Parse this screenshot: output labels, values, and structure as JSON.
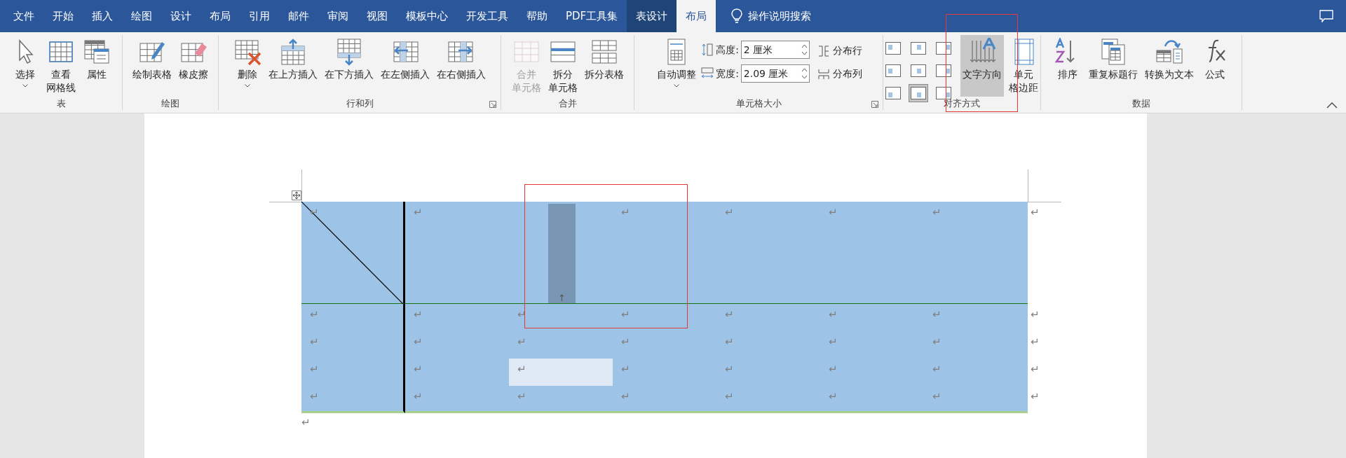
{
  "tabs": [
    {
      "label": "文件",
      "kind": "plain",
      "selected": false
    },
    {
      "label": "开始",
      "kind": "plain",
      "selected": false
    },
    {
      "label": "插入",
      "kind": "plain",
      "selected": false
    },
    {
      "label": "绘图",
      "kind": "plain",
      "selected": false
    },
    {
      "label": "设计",
      "kind": "plain",
      "selected": false
    },
    {
      "label": "布局",
      "kind": "plain",
      "selected": false
    },
    {
      "label": "引用",
      "kind": "plain",
      "selected": false
    },
    {
      "label": "邮件",
      "kind": "plain",
      "selected": false
    },
    {
      "label": "审阅",
      "kind": "plain",
      "selected": false
    },
    {
      "label": "视图",
      "kind": "plain",
      "selected": false
    },
    {
      "label": "模板中心",
      "kind": "plain",
      "selected": false
    },
    {
      "label": "开发工具",
      "kind": "plain",
      "selected": false
    },
    {
      "label": "帮助",
      "kind": "plain",
      "selected": false
    },
    {
      "label": "PDF工具集",
      "kind": "plain",
      "selected": false
    },
    {
      "label": "表设计",
      "kind": "contextual",
      "selected": false
    },
    {
      "label": "布局",
      "kind": "contextual",
      "selected": true
    }
  ],
  "tell_me": "操作说明搜索",
  "groups": [
    {
      "label": "表",
      "items": [
        {
          "kind": "large",
          "lines": [
            "选择"
          ],
          "dropdown": true,
          "disabled": false,
          "selected": false
        },
        {
          "kind": "large",
          "lines": [
            "查看",
            "网格线"
          ],
          "dropdown": false,
          "disabled": false,
          "selected": false
        },
        {
          "kind": "large",
          "lines": [
            "属性"
          ],
          "dropdown": false,
          "disabled": false,
          "selected": false
        }
      ]
    },
    {
      "label": "绘图",
      "items": [
        {
          "kind": "large",
          "lines": [
            "绘制表格"
          ],
          "dropdown": false,
          "disabled": false,
          "selected": false
        },
        {
          "kind": "large",
          "lines": [
            "橡皮擦"
          ],
          "dropdown": false,
          "disabled": false,
          "selected": false
        }
      ]
    },
    {
      "label": "行和列",
      "launcher": true,
      "items": [
        {
          "kind": "large",
          "lines": [
            "删除"
          ],
          "dropdown": true,
          "disabled": false,
          "selected": false
        },
        {
          "kind": "large",
          "lines": [
            "在上方插入"
          ],
          "dropdown": false,
          "disabled": false,
          "selected": false
        },
        {
          "kind": "large",
          "lines": [
            "在下方插入"
          ],
          "dropdown": false,
          "disabled": false,
          "selected": false
        },
        {
          "kind": "large",
          "lines": [
            "在左侧插入"
          ],
          "dropdown": false,
          "disabled": false,
          "selected": false
        },
        {
          "kind": "large",
          "lines": [
            "在右侧插入"
          ],
          "dropdown": false,
          "disabled": false,
          "selected": false
        }
      ]
    },
    {
      "label": "合并",
      "items": [
        {
          "kind": "large",
          "lines": [
            "合并",
            "单元格"
          ],
          "dropdown": false,
          "disabled": true,
          "selected": false
        },
        {
          "kind": "large",
          "lines": [
            "拆分",
            "单元格"
          ],
          "dropdown": false,
          "disabled": false,
          "selected": false
        },
        {
          "kind": "large",
          "lines": [
            "拆分表格"
          ],
          "dropdown": false,
          "disabled": false,
          "selected": false
        }
      ]
    },
    {
      "label": "单元格大小",
      "launcher": true,
      "items": [
        {
          "kind": "large",
          "lines": [
            "自动调整"
          ],
          "dropdown": true,
          "disabled": false,
          "selected": false
        },
        {
          "kind": "size",
          "fields": [
            {
              "label": "高度:",
              "value": "2 厘米"
            },
            {
              "label": "宽度:",
              "value": "2.09 厘米"
            }
          ],
          "buttons": [
            "分布行",
            "分布列"
          ]
        }
      ]
    },
    {
      "label": "对齐方式",
      "items": [
        {
          "kind": "align",
          "cells": [
            {
              "selected": false
            },
            {
              "selected": false
            },
            {
              "selected": false
            },
            {
              "selected": false
            },
            {
              "selected": false
            },
            {
              "selected": false
            },
            {
              "selected": false
            },
            {
              "selected": true
            },
            {
              "selected": false
            }
          ]
        },
        {
          "kind": "large",
          "lines": [
            "文字方向"
          ],
          "dropdown": false,
          "disabled": false,
          "selected": true
        },
        {
          "kind": "large",
          "lines": [
            "单元",
            "格边距"
          ],
          "dropdown": false,
          "disabled": false,
          "selected": false
        }
      ]
    },
    {
      "label": "数据",
      "items": [
        {
          "kind": "large",
          "lines": [
            "排序"
          ],
          "dropdown": false,
          "disabled": false,
          "selected": false
        },
        {
          "kind": "large",
          "lines": [
            "重复标题行"
          ],
          "dropdown": false,
          "disabled": false,
          "selected": false
        },
        {
          "kind": "large",
          "lines": [
            "转换为文本"
          ],
          "dropdown": false,
          "disabled": false,
          "selected": false
        },
        {
          "kind": "large",
          "lines": [
            "公式"
          ],
          "dropdown": false,
          "disabled": false,
          "selected": false
        }
      ]
    }
  ],
  "table": {
    "rows": [
      {
        "tall": true,
        "end": "↵",
        "cells": [
          {
            "kind": "diagonal",
            "text": "↵"
          },
          {
            "kind": "mark",
            "text": "↵"
          },
          {
            "kind": "bar",
            "text": "↑"
          },
          {
            "kind": "mark",
            "text": "↵"
          },
          {
            "kind": "mark",
            "text": "↵"
          },
          {
            "kind": "mark",
            "text": "↵"
          },
          {
            "kind": "mark",
            "text": "↵"
          }
        ]
      },
      {
        "tall": false,
        "end": "↵",
        "cells": [
          {
            "kind": "mark",
            "text": "↵"
          },
          {
            "kind": "mark",
            "text": "↵"
          },
          {
            "kind": "mark",
            "text": "↵"
          },
          {
            "kind": "mark",
            "text": "↵"
          },
          {
            "kind": "mark",
            "text": "↵"
          },
          {
            "kind": "mark",
            "text": "↵"
          },
          {
            "kind": "mark",
            "text": "↵"
          }
        ]
      },
      {
        "tall": false,
        "end": "↵",
        "cells": [
          {
            "kind": "mark",
            "text": "↵"
          },
          {
            "kind": "mark",
            "text": "↵"
          },
          {
            "kind": "mark",
            "text": "↵"
          },
          {
            "kind": "mark",
            "text": "↵"
          },
          {
            "kind": "mark",
            "text": "↵"
          },
          {
            "kind": "mark",
            "text": "↵"
          },
          {
            "kind": "mark",
            "text": "↵"
          }
        ]
      },
      {
        "tall": false,
        "end": "↵",
        "cells": [
          {
            "kind": "mark",
            "text": "↵"
          },
          {
            "kind": "mark",
            "text": "↵"
          },
          {
            "kind": "highlight",
            "text": "↵"
          },
          {
            "kind": "mark",
            "text": "↵"
          },
          {
            "kind": "mark",
            "text": "↵"
          },
          {
            "kind": "mark",
            "text": "↵"
          },
          {
            "kind": "mark",
            "text": "↵"
          }
        ]
      },
      {
        "tall": false,
        "end": "↵",
        "cells": [
          {
            "kind": "mark",
            "text": "↵"
          },
          {
            "kind": "mark",
            "text": "↵"
          },
          {
            "kind": "mark",
            "text": "↵"
          },
          {
            "kind": "mark",
            "text": "↵"
          },
          {
            "kind": "mark",
            "text": "↵"
          },
          {
            "kind": "mark",
            "text": "↵"
          },
          {
            "kind": "mark",
            "text": "↵"
          }
        ]
      }
    ],
    "after": "↵"
  }
}
